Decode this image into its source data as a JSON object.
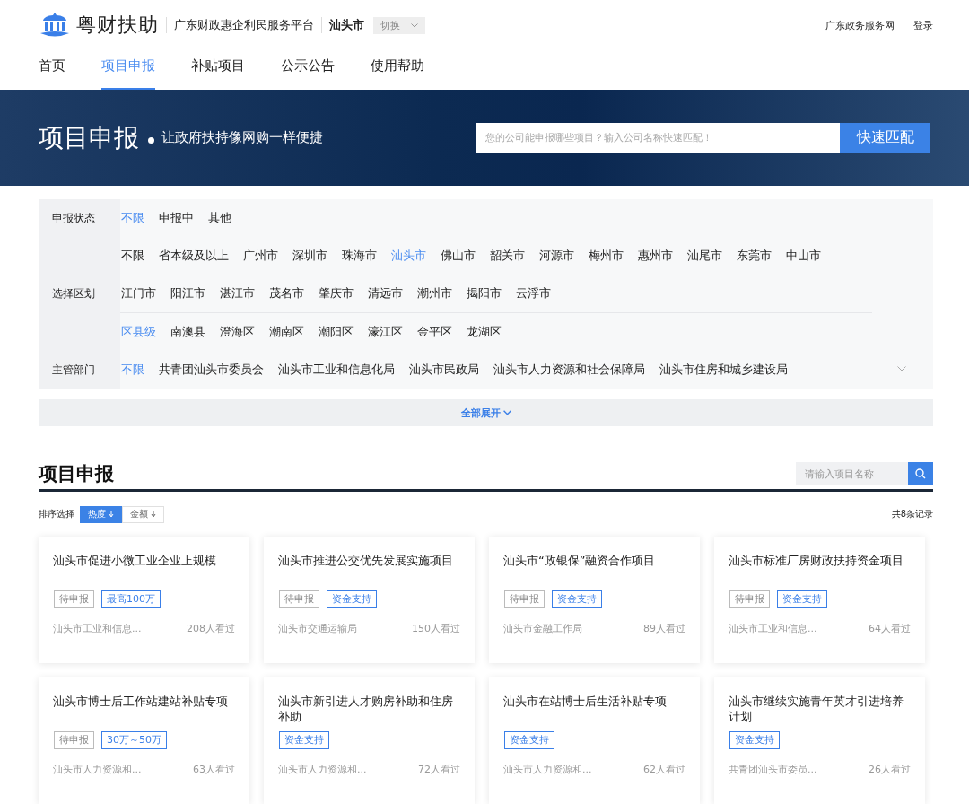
{
  "header": {
    "brand": "粤财扶助",
    "platform": "广东财政惠企利民服务平台",
    "city": "汕头市",
    "switch_button": "切换",
    "links": [
      "广东政务服务网",
      "登录"
    ]
  },
  "nav": [
    {
      "label": "首页",
      "selected": false
    },
    {
      "label": "项目申报",
      "selected": true
    },
    {
      "label": "补贴项目",
      "selected": false
    },
    {
      "label": "公示公告",
      "selected": false
    },
    {
      "label": "使用帮助",
      "selected": false
    }
  ],
  "banner": {
    "title": "项目申报",
    "subtitle": "让政府扶持像网购一样便捷",
    "search": {
      "placeholder": "您的公司能申报哪些项目？输入公司名称快速匹配！"
    },
    "button": "快速匹配"
  },
  "filters": [
    {
      "label": "申报状态",
      "groups": [
        {
          "rows": [
            [
              {
                "text": "不限",
                "selected": true
              },
              {
                "text": "申报中",
                "selected": false
              },
              {
                "text": "其他",
                "selected": false
              }
            ]
          ]
        }
      ]
    },
    {
      "label": "选择区划",
      "groups": [
        {
          "rows": [
            [
              {
                "text": "不限",
                "selected": false
              },
              {
                "text": "省本级及以上",
                "selected": false
              },
              {
                "text": "广州市",
                "selected": false
              },
              {
                "text": "深圳市",
                "selected": false
              },
              {
                "text": "珠海市",
                "selected": false
              },
              {
                "text": "汕头市",
                "selected": true
              },
              {
                "text": "佛山市",
                "selected": false
              },
              {
                "text": "韶关市",
                "selected": false
              },
              {
                "text": "河源市",
                "selected": false
              },
              {
                "text": "梅州市",
                "selected": false
              },
              {
                "text": "惠州市",
                "selected": false
              },
              {
                "text": "汕尾市",
                "selected": false
              },
              {
                "text": "东莞市",
                "selected": false
              },
              {
                "text": "中山市",
                "selected": false
              }
            ],
            [
              {
                "text": "江门市",
                "selected": false
              },
              {
                "text": "阳江市",
                "selected": false
              },
              {
                "text": "湛江市",
                "selected": false
              },
              {
                "text": "茂名市",
                "selected": false
              },
              {
                "text": "肇庆市",
                "selected": false
              },
              {
                "text": "清远市",
                "selected": false
              },
              {
                "text": "潮州市",
                "selected": false
              },
              {
                "text": "揭阳市",
                "selected": false
              },
              {
                "text": "云浮市",
                "selected": false
              }
            ]
          ]
        },
        {
          "rows": [
            [
              {
                "text": "区县级",
                "selected": true
              },
              {
                "text": "南澳县",
                "selected": false
              },
              {
                "text": "澄海区",
                "selected": false
              },
              {
                "text": "潮南区",
                "selected": false
              },
              {
                "text": "潮阳区",
                "selected": false
              },
              {
                "text": "濠江区",
                "selected": false
              },
              {
                "text": "金平区",
                "selected": false
              },
              {
                "text": "龙湖区",
                "selected": false
              }
            ]
          ]
        }
      ]
    },
    {
      "label": "主管部门",
      "expandable": true,
      "groups": [
        {
          "rows": [
            [
              {
                "text": "不限",
                "selected": true
              },
              {
                "text": "共青团汕头市委员会",
                "selected": false
              },
              {
                "text": "汕头市工业和信息化局",
                "selected": false
              },
              {
                "text": "汕头市民政局",
                "selected": false
              },
              {
                "text": "汕头市人力资源和社会保障局",
                "selected": false
              },
              {
                "text": "汕头市住房和城乡建设局",
                "selected": false
              }
            ]
          ]
        }
      ]
    }
  ],
  "expand_all": "全部展开",
  "section": {
    "title": "项目申报",
    "search": {
      "placeholder": "请输入项目名称"
    },
    "sort_label": "排序选择",
    "sort": [
      {
        "label": "热度",
        "selected": true
      },
      {
        "label": "金额",
        "selected": false
      }
    ],
    "total": "共8条记录"
  },
  "cards": [
    {
      "title": "汕头市促进小微工业企业上规模",
      "tags": [
        {
          "text": "待申报",
          "kind": "status"
        },
        {
          "text": "最高100万",
          "kind": "funding"
        }
      ],
      "department": "汕头市工业和信息...",
      "views": "208人看过"
    },
    {
      "title": "汕头市推进公交优先发展实施项目",
      "tags": [
        {
          "text": "待申报",
          "kind": "status"
        },
        {
          "text": "资金支持",
          "kind": "funding"
        }
      ],
      "department": "汕头市交通运输局",
      "views": "150人看过"
    },
    {
      "title": "汕头市“政银保”融资合作项目",
      "tags": [
        {
          "text": "待申报",
          "kind": "status"
        },
        {
          "text": "资金支持",
          "kind": "funding"
        }
      ],
      "department": "汕头市金融工作局",
      "views": "89人看过"
    },
    {
      "title": "汕头市标准厂房财政扶持资金项目",
      "tags": [
        {
          "text": "待申报",
          "kind": "status"
        },
        {
          "text": "资金支持",
          "kind": "funding"
        }
      ],
      "department": "汕头市工业和信息...",
      "views": "64人看过"
    },
    {
      "title": "汕头市博士后工作站建站补贴专项",
      "tags": [
        {
          "text": "待申报",
          "kind": "status"
        },
        {
          "text": "30万～50万",
          "kind": "funding"
        }
      ],
      "department": "汕头市人力资源和...",
      "views": "63人看过"
    },
    {
      "title": "汕头市新引进人才购房补助和住房补助",
      "tags": [
        {
          "text": "资金支持",
          "kind": "funding"
        }
      ],
      "department": "汕头市人力资源和...",
      "views": "72人看过"
    },
    {
      "title": "汕头市在站博士后生活补贴专项",
      "tags": [
        {
          "text": "资金支持",
          "kind": "funding"
        }
      ],
      "department": "汕头市人力资源和...",
      "views": "62人看过"
    },
    {
      "title": "汕头市继续实施青年英才引进培养计划",
      "tags": [
        {
          "text": "资金支持",
          "kind": "funding"
        }
      ],
      "department": "共青团汕头市委员...",
      "views": "26人看过"
    }
  ]
}
